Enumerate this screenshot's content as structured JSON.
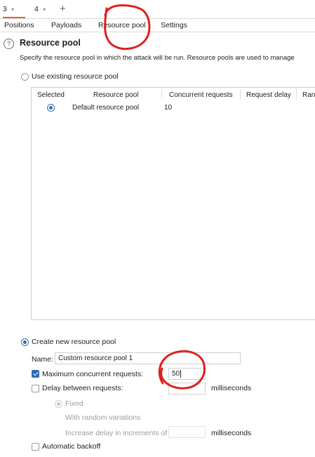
{
  "top_tabs": [
    {
      "label": "3",
      "close": "×",
      "active": true
    },
    {
      "label": "4",
      "close": "×",
      "active": false
    }
  ],
  "add_tab": "+",
  "section_tabs": [
    "Positions",
    "Payloads",
    "Resource pool",
    "Settings"
  ],
  "help_icon": "?",
  "page": {
    "title": "Resource pool",
    "description": "Specify the resource pool in which the attack will be run. Resource pools are used to manage"
  },
  "use_existing": {
    "label": "Use existing resource pool",
    "selected": false
  },
  "pool_table": {
    "headers": [
      "Selected",
      "Resource pool",
      "Concurrent requests",
      "Request delay",
      "Ran"
    ],
    "rows": [
      {
        "selected": true,
        "name": "Default resource pool",
        "concurrent": "10",
        "delay": "",
        "random": ""
      }
    ]
  },
  "create_new": {
    "label": "Create new resource pool",
    "selected": true,
    "name_label": "Name:",
    "name_value": "Custom resource pool 1",
    "max_concurrent": {
      "label": "Maximum concurrent requests:",
      "checked": true,
      "value": "50"
    },
    "delay_between": {
      "label": "Delay between requests:",
      "checked": false,
      "value": "",
      "unit": "milliseconds"
    },
    "fixed": {
      "label": "Fixed",
      "selected": true
    },
    "random_variations": {
      "label": "With random variations"
    },
    "increase_delay": {
      "label": "Increase delay in increments of",
      "value": "",
      "unit": "milliseconds"
    },
    "automatic_backoff": {
      "label": "Automatic backoff",
      "checked": false
    }
  },
  "colors": {
    "accent_tab": "#e8632b",
    "control_blue": "#2f6db5",
    "annotation_red": "#e0201e"
  }
}
